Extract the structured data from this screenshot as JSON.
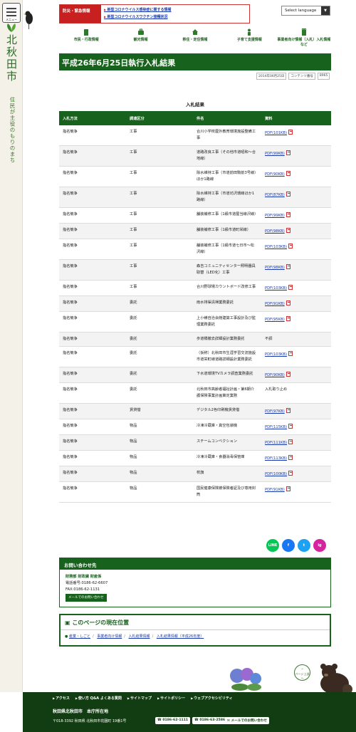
{
  "sidebar": {
    "menu_label": "メニュー",
    "city_name": "北秋田市",
    "slogan": "住民が主役のもりのまち"
  },
  "emergency": {
    "title": "防災・緊急情報",
    "links": [
      "新型コロナウイルス感染症に関する情報",
      "新型コロナウイルスワクチン接種状況"
    ]
  },
  "language_select": {
    "label": "Select language"
  },
  "global_nav": [
    {
      "label": "市民・行政情報",
      "icon": "building-icon"
    },
    {
      "label": "観光情報",
      "icon": "suitcase-icon"
    },
    {
      "label": "移住・定住情報",
      "icon": "house-icon"
    },
    {
      "label": "子育て支援情報",
      "icon": "child-icon"
    },
    {
      "label": "事業者向け情報（入札）入札情報など",
      "icon": "office-icon"
    }
  ],
  "page": {
    "title": "平成26年6月25日執行入札結果",
    "date": "2014年06月25日",
    "content_no_label": "コンテンツ番号",
    "content_no": "8965"
  },
  "section_title": "入札結果",
  "table": {
    "headers": [
      "入札方法",
      "調達区分",
      "件名",
      "資料"
    ],
    "rows": [
      {
        "method": "指名競争",
        "category": "工事",
        "subject": "合川小学校屋外教育環境施設整備工事",
        "doc": "PDF(101KB)",
        "is_pdf": true
      },
      {
        "method": "指名競争",
        "category": "工事",
        "subject": "道路改良工事（その他市道昭和～合地線）",
        "doc": "PDF(99KB)",
        "is_pdf": true
      },
      {
        "method": "指名競争",
        "category": "工事",
        "subject": "除水維持工事（市道前田駒前3号線）ほか1路線",
        "doc": "PDF(90KB)",
        "is_pdf": true
      },
      {
        "method": "指名競争",
        "category": "工事",
        "subject": "除水維持工事（市道坊沢環線ほか1路線）",
        "doc": "PDF(87KB)",
        "is_pdf": true
      },
      {
        "method": "指名競争",
        "category": "工事",
        "subject": "舗装補修工事（1級市道屋当線沢線）",
        "doc": "PDF(99KB)",
        "is_pdf": true
      },
      {
        "method": "指名競争",
        "category": "工事",
        "subject": "舗装補修工事（1級市道町栄線）",
        "doc": "PDF(98KB)",
        "is_pdf": true
      },
      {
        "method": "指名競争",
        "category": "工事",
        "subject": "舗装補修工事（1級市道七日市～松沢線）",
        "doc": "PDF(103KB)",
        "is_pdf": true
      },
      {
        "method": "指名競争",
        "category": "工事",
        "subject": "森吉コミュニティセンター照明器具取替（LED化）工事",
        "doc": "PDF(98KB)",
        "is_pdf": true
      },
      {
        "method": "指名競争",
        "category": "工事",
        "subject": "合川野球場カウントボード改修工事",
        "doc": "PDF(103KB)",
        "is_pdf": true
      },
      {
        "method": "指名競争",
        "category": "委託",
        "subject": "雨水排渠清掃業務委託",
        "doc": "PDF(91KB)",
        "is_pdf": true
      },
      {
        "method": "指名競争",
        "category": "委託",
        "subject": "上小様自治会館建築工事設計及び監理業務委託",
        "doc": "PDF(95KB)",
        "is_pdf": true
      },
      {
        "method": "指名競争",
        "category": "委託",
        "subject": "歩道橋撤去詳細設計業務委託",
        "doc": "不調",
        "is_pdf": false
      },
      {
        "method": "指名競争",
        "category": "委託",
        "subject": "（仮称）北秋田市生涯学習交流施設市道栄町線道路詳細設計業務委託",
        "doc": "PDF(103KB)",
        "is_pdf": true
      },
      {
        "method": "指名競争",
        "category": "委託",
        "subject": "下水道環境TVカメラ調査業務委託",
        "doc": "PDF(90KB)",
        "is_pdf": true
      },
      {
        "method": "指名競争",
        "category": "委託",
        "subject": "北秋田市高齢者福祉計画・第6期介護保険事業計画策定業務",
        "doc": "入札取り止め",
        "is_pdf": false
      },
      {
        "method": "指名競争",
        "category": "賃貸借",
        "subject": "デジタル2色印刷機賃貸借",
        "doc": "PDF(97KB)",
        "is_pdf": true
      },
      {
        "method": "指名競争",
        "category": "物品",
        "subject": "冷凍冷蔵庫・真空包装機",
        "doc": "PDF(115KB)",
        "is_pdf": true
      },
      {
        "method": "指名競争",
        "category": "物品",
        "subject": "スチームコンベクション",
        "doc": "PDF(111KB)",
        "is_pdf": true
      },
      {
        "method": "指名競争",
        "category": "物品",
        "subject": "冷凍冷蔵庫・食器消毒保管庫",
        "doc": "PDF(113KB)",
        "is_pdf": true
      },
      {
        "method": "指名競争",
        "category": "物品",
        "subject": "校旗",
        "doc": "PDF(100KB)",
        "is_pdf": true
      },
      {
        "method": "指名競争",
        "category": "物品",
        "subject": "国民健康保険被保険者証及び専用封筒",
        "doc": "PDF(91KB)",
        "is_pdf": true
      }
    ]
  },
  "social": [
    {
      "name": "line-icon",
      "label": "LINE",
      "color": "#06c755"
    },
    {
      "name": "facebook-icon",
      "label": "f",
      "color": "#1877f2"
    },
    {
      "name": "twitter-icon",
      "label": "t",
      "color": "#1da1f2"
    },
    {
      "name": "instagram-icon",
      "label": "ig",
      "color": "#d6249f"
    }
  ],
  "contact": {
    "title": "お問い合わせ先",
    "dept": "財務部 財政課 財産係",
    "tel": "電話番号:0186-62-6607",
    "fax": "FAX:0186-62-1131",
    "mail_label": "メールでのお問い合わせ"
  },
  "location": {
    "title": "このページの現在位置",
    "crumbs": [
      "産業・しごと",
      "事業者向け情報",
      "入札結果情報",
      "入札結果情報（平成26年度）"
    ]
  },
  "pagetop": {
    "label": "ページ上部へ"
  },
  "footer": {
    "links": [
      "アクセス",
      "使い方 Q&A よくある質問",
      "サイトマップ",
      "サイトポリシー",
      "ウェブアクセシビリティ"
    ],
    "office": "秋田県北秋田市　本庁所在地",
    "address": "〒018-3392 秋田県 北秋田市花園町 19番1号",
    "tel1": "0186-62-1111",
    "tel2": "0186-63-2586",
    "mail": "メールでのお問い合わせ"
  }
}
